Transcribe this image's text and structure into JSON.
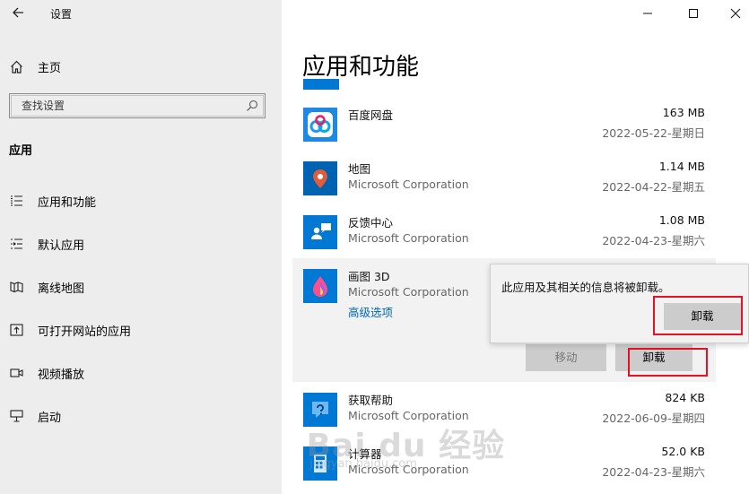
{
  "window": {
    "title": "设置",
    "back_icon": "back-arrow-icon",
    "minimize_icon": "minimize-icon",
    "maximize_icon": "maximize-icon",
    "close_icon": "close-icon"
  },
  "sidebar": {
    "home_label": "主页",
    "search_placeholder": "查找设置",
    "section_title": "应用",
    "items": [
      {
        "label": "应用和功能",
        "icon": "apps-features-icon"
      },
      {
        "label": "默认应用",
        "icon": "default-apps-icon"
      },
      {
        "label": "离线地图",
        "icon": "offline-maps-icon"
      },
      {
        "label": "可打开网站的应用",
        "icon": "apps-for-websites-icon"
      },
      {
        "label": "视频播放",
        "icon": "video-playback-icon"
      },
      {
        "label": "启动",
        "icon": "startup-icon"
      }
    ]
  },
  "main": {
    "title": "应用和功能",
    "apps": [
      {
        "name": "百度网盘",
        "publisher": "",
        "size": "163 MB",
        "date": "2022-05-22-星期日",
        "icon": "baidu-netdisk-icon"
      },
      {
        "name": "地图",
        "publisher": "Microsoft Corporation",
        "size": "1.14 MB",
        "date": "2022-04-22-星期五",
        "icon": "maps-icon"
      },
      {
        "name": "反馈中心",
        "publisher": "Microsoft Corporation",
        "size": "1.08 MB",
        "date": "2022-04-23-星期六",
        "icon": "feedback-hub-icon"
      },
      {
        "name": "画图 3D",
        "publisher": "Microsoft Corporation",
        "size": "",
        "date": "",
        "icon": "paint-3d-icon",
        "advanced": "高级选项",
        "move_label": "移动",
        "uninstall_label": "卸载"
      },
      {
        "name": "获取帮助",
        "publisher": "Microsoft Corporation",
        "size": "824 KB",
        "date": "2022-06-09-星期四",
        "icon": "get-help-icon"
      },
      {
        "name": "计算器",
        "publisher": "Microsoft Corporation",
        "size": "52.0 KB",
        "date": "2022-04-23-星期六",
        "icon": "calculator-icon"
      }
    ]
  },
  "popup": {
    "message": "此应用及其相关的信息将被卸载。",
    "button": "卸载"
  },
  "watermark": {
    "text": "Bai du 经验",
    "sub": "jingyan.baidu.com"
  },
  "colors": {
    "sidebar_bg": "#ededed",
    "accent": "#0078d4",
    "link": "#0067b8",
    "highlight": "#e81123"
  }
}
